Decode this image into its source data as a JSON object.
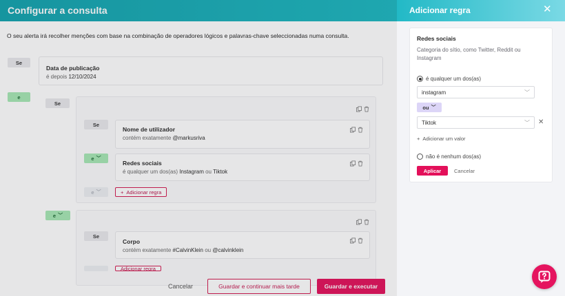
{
  "left": {
    "title": "Configurar a consulta",
    "intro": "O seu alerta irá recolher menções com base na combinação de operadores lógicos e palavras-chave seleccionadas numa consulta.",
    "root_tag": "Se",
    "date_rule": {
      "title": "Data de publicação",
      "prefix": "é depois",
      "value": "12/10/2024"
    },
    "and_tag": "e",
    "group1": {
      "se_tag": "Se",
      "rules": [
        {
          "tag": "Se",
          "title": "Nome de utilizador",
          "prefix": "contém exatamente",
          "values": [
            "@markusriva"
          ],
          "joiner": ""
        },
        {
          "tag": "e",
          "title": "Redes sociais",
          "prefix": "é qualquer um dos(as)",
          "values": [
            "Instagram",
            "Tiktok"
          ],
          "joiner": "ou"
        }
      ],
      "disabled_tag": "e",
      "add_rule": "Adicionar regra"
    },
    "group2": {
      "join_tag": "e",
      "rules": [
        {
          "tag": "Se",
          "title": "Corpo",
          "prefix": "contém exatamente",
          "values": [
            "#CalvinKlein",
            "@calvinklein"
          ],
          "joiner": "ou"
        }
      ],
      "add_rule": "Adicionar regra"
    },
    "footer": {
      "cancel": "Cancelar",
      "save_later": "Guardar e continuar mais tarde",
      "save_run": "Guardar e executar"
    }
  },
  "right": {
    "title": "Adicionar regra",
    "close_icon": "close-icon",
    "card": {
      "title": "Redes sociais",
      "description": "Categoria do sítio, como Twitter, Reddit ou Instagram",
      "option_any": "é qualquer um dos(as)",
      "option_any_selected": true,
      "values": [
        "instagram",
        "Tiktok"
      ],
      "or_label": "ou",
      "add_value": "Adicionar um valor",
      "option_none": "não é nenhum dos(as)",
      "apply": "Aplicar",
      "cancel": "Cancelar"
    }
  },
  "colors": {
    "accent": "#e3105a",
    "header": "#1bb7c0",
    "and_tag": "#a6e7b4",
    "or_tag": "#dcd5f7"
  }
}
